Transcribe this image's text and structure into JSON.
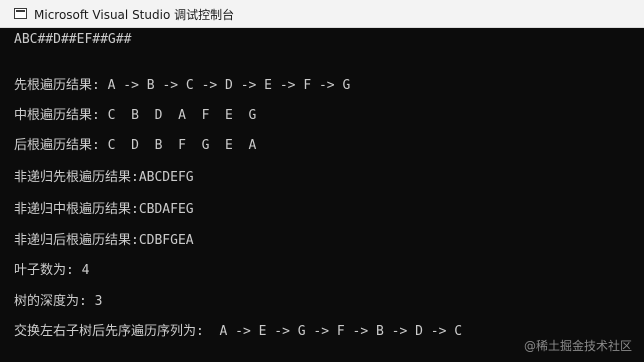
{
  "window": {
    "title": "Microsoft Visual Studio 调试控制台"
  },
  "console": {
    "lines": [
      "ABC##D##EF##G##",
      "",
      "先根遍历结果: A -> B -> C -> D -> E -> F -> G",
      "中根遍历结果: C  B  D  A  F  E  G",
      "后根遍历结果: C  D  B  F  G  E  A",
      "非递归先根遍历结果:ABCDEFG",
      "非递归中根遍历结果:CBDAFEG",
      "非递归后根遍历结果:CDBFGEA",
      "叶子数为: 4",
      "树的深度为: 3",
      "交换左右子树后先序遍历序列为:  A -> E -> G -> F -> B -> D -> C"
    ]
  },
  "watermark": "@稀土掘金技术社区"
}
